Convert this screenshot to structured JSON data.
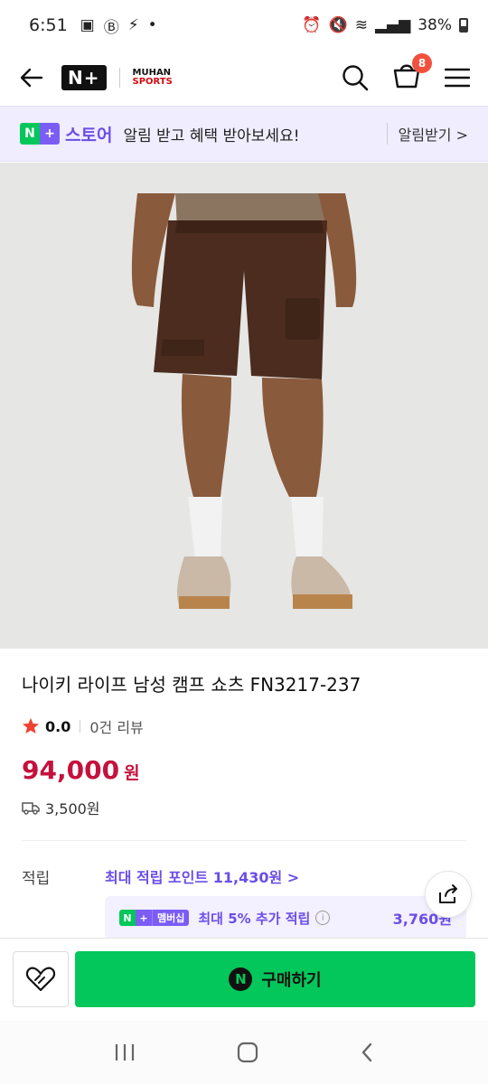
{
  "status_bar": {
    "time": "6:51",
    "battery": "38%"
  },
  "header": {
    "platform_logo": "N+",
    "brand_logo_top": "MUHAN",
    "brand_logo_bottom": "SPORTS",
    "cart_count": "8"
  },
  "banner": {
    "logo_n": "N",
    "logo_plus": "+",
    "store": "스토어",
    "message": "알림 받고 혜택 받아보세요!",
    "action": "알림받기 >"
  },
  "product": {
    "title": "나이키 라이프 남성 캠프 쇼츠 FN3217-237",
    "rating": "0.0",
    "reviews": "0건 리뷰",
    "price": "94,000",
    "currency": "원",
    "shipping": "3,500원"
  },
  "points": {
    "label": "적립",
    "max": "최대 적립 포인트 11,430원 >",
    "member_tag": "멤버십",
    "member_text": "최대 5% 추가 적립",
    "member_value": "3,760원"
  },
  "bottom": {
    "buy_label": "구매하기",
    "buy_icon": "N"
  },
  "icons": {
    "back": "back-arrow-icon",
    "search": "search-icon",
    "cart": "cart-icon",
    "menu": "menu-icon",
    "share": "share-icon",
    "wish": "heart-icon"
  },
  "colors": {
    "accent_green": "#03c75a",
    "accent_purple": "#6a4ee8",
    "price_red": "#c5113c"
  }
}
